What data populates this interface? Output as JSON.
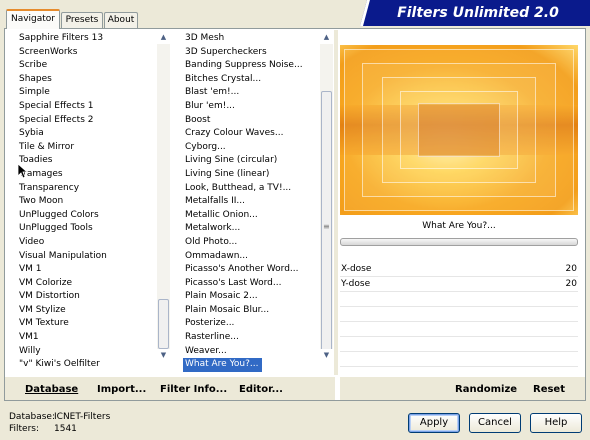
{
  "tabs": [
    {
      "label": "Navigator",
      "active": true
    },
    {
      "label": "Presets",
      "active": false
    },
    {
      "label": "About",
      "active": false
    }
  ],
  "app_title": "Filters Unlimited 2.0",
  "categories": [
    "Sapphire Filters 13",
    "ScreenWorks",
    "Scribe",
    "Shapes",
    "Simple",
    "Special Effects 1",
    "Special Effects 2",
    "Sybia",
    "Tile & Mirror",
    "Toadies",
    "Tramages",
    "Transparency",
    "Two Moon",
    "UnPlugged Colors",
    "UnPlugged Tools",
    "Video",
    "Visual Manipulation",
    "VM 1",
    "VM Colorize",
    "VM Distortion",
    "VM Stylize",
    "VM Texture",
    "VM1",
    "Willy",
    "\"v\" Kiwi's Oelfilter"
  ],
  "filters": [
    "3D Mesh",
    "3D Supercheckers",
    "Banding Suppress Noise...",
    "Bitches Crystal...",
    "Blast 'em!...",
    "Blur 'em!...",
    "Boost",
    "Crazy Colour Waves...",
    "Cyborg...",
    "Living Sine (circular)",
    "Living Sine (linear)",
    "Look, Butthead, a TV!...",
    "Metalfalls II...",
    "Metallic Onion...",
    "Metalwork...",
    "Old Photo...",
    "Ommadawn...",
    "Picasso's Another Word...",
    "Picasso's Last Word...",
    "Plain Mosaic 2...",
    "Plain Mosaic Blur...",
    "Posterize...",
    "Rasterline...",
    "Weaver...",
    "What Are You?..."
  ],
  "selected_filter": "What Are You?...",
  "preview_filter_name": "What Are You?...",
  "params": [
    {
      "label": "X-dose",
      "value": "20"
    },
    {
      "label": "Y-dose",
      "value": "20"
    }
  ],
  "toolbar": {
    "database": "Database",
    "import": "Import...",
    "filter_info": "Filter Info...",
    "editor": "Editor...",
    "randomize": "Randomize",
    "reset": "Reset"
  },
  "status": {
    "database_label": "Database:",
    "database_value": "ICNET-Filters",
    "filters_label": "Filters:",
    "filters_value": "1541"
  },
  "buttons": {
    "apply": "Apply",
    "cancel": "Cancel",
    "help": "Help"
  },
  "colors": {
    "selection": "#316ac5",
    "banner": "#0a1a8c",
    "preview_orange": "#f39e1a"
  }
}
